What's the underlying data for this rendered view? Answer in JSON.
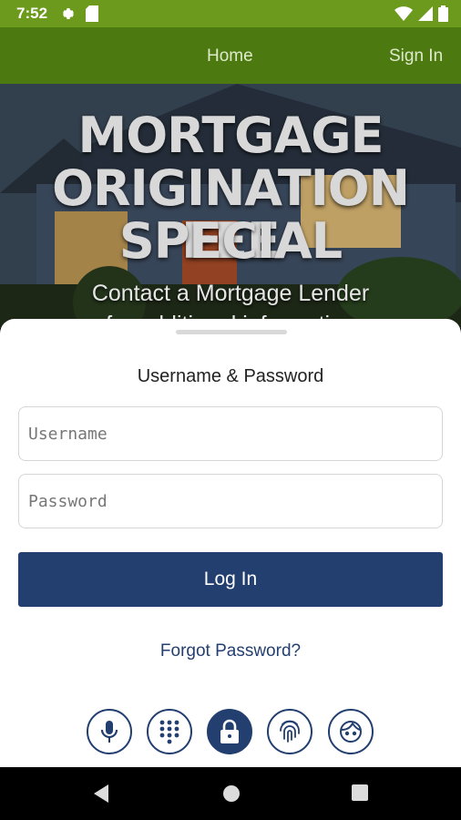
{
  "status": {
    "time": "7:52"
  },
  "header": {
    "nav": {
      "home": "Home",
      "sign_in": "Sign In"
    }
  },
  "hero": {
    "title_lines": [
      "MORTGAGE",
      "ORIGINATION FEE",
      "SPECIAL"
    ],
    "subtitle": "Contact a Mortgage Lender",
    "subtitle_cut": "for additional information"
  },
  "login": {
    "heading": "Username & Password",
    "username_placeholder": "Username",
    "password_placeholder": "Password",
    "login_label": "Log In",
    "forgot_label": "Forgot Password?",
    "auth_methods": [
      "microphone-icon",
      "keypad-icon",
      "lock-icon",
      "fingerprint-icon",
      "face-icon"
    ],
    "active_method": "lock-icon"
  },
  "colors": {
    "status_bar": "#6b9a1c",
    "app_bar": "#4c7a10",
    "primary": "#233f70"
  }
}
